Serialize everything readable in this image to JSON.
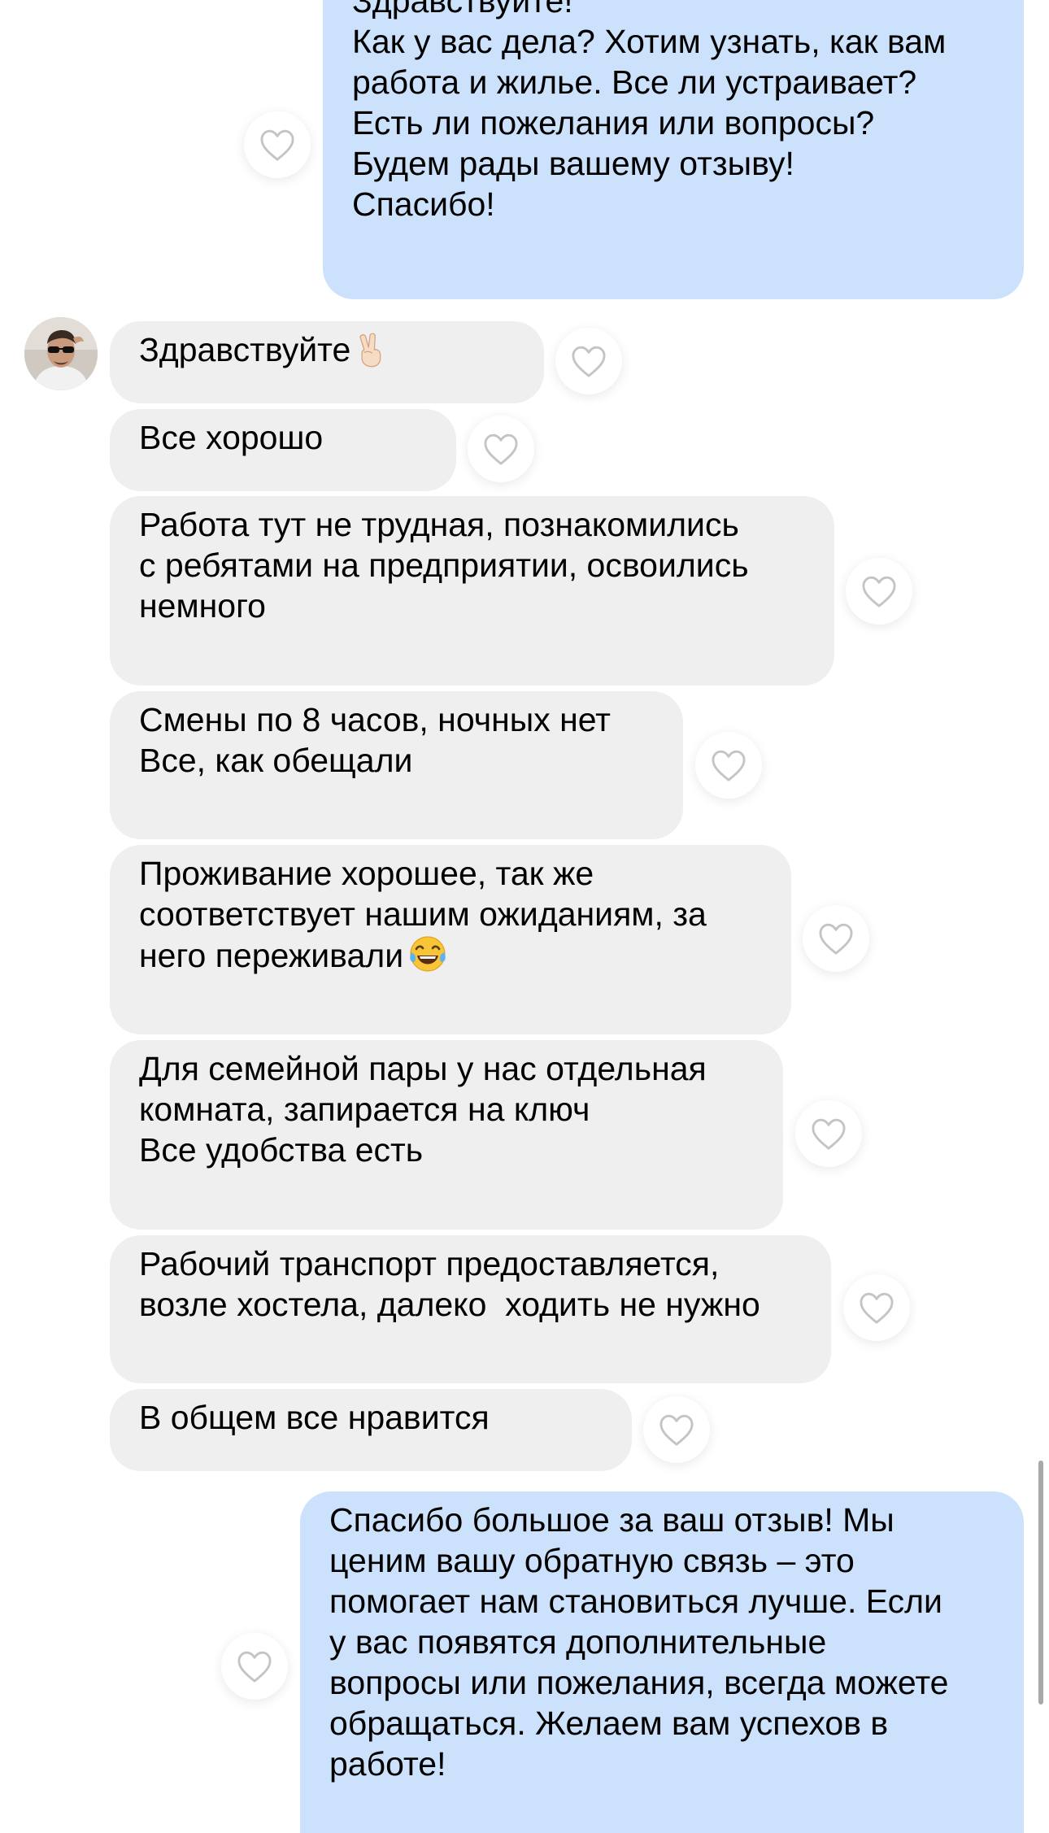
{
  "chat": {
    "messages": [
      {
        "id": "m1",
        "direction": "outgoing",
        "lines": [
          "Здравствуйте!",
          "Как у вас дела? Хотим узнать, как вам",
          "работа и жилье. Все ли устраивает?",
          "Есть ли пожелания или вопросы?",
          "Будем рады вашему отзыву!",
          "Спасибо!"
        ]
      },
      {
        "id": "m2",
        "direction": "incoming",
        "lines": [
          "Здравствуйте"
        ],
        "emoji": "victory-hand-emoji"
      },
      {
        "id": "m3",
        "direction": "incoming",
        "lines": [
          "Все хорошо"
        ]
      },
      {
        "id": "m4",
        "direction": "incoming",
        "lines": [
          "Работа тут не трудная, познакомились",
          "с ребятами на предприятии, освоились",
          "немного"
        ]
      },
      {
        "id": "m5",
        "direction": "incoming",
        "lines": [
          "Смены по 8 часов, ночных нет",
          "Все, как обещали"
        ]
      },
      {
        "id": "m6",
        "direction": "incoming",
        "lines": [
          "Проживание хорошее, так же",
          "соответствует нашим ожиданиям, за",
          "него переживали"
        ],
        "emoji": "tears-of-joy-emoji"
      },
      {
        "id": "m7",
        "direction": "incoming",
        "lines": [
          "Для семейной пары у нас отдельная",
          "комната, запирается на ключ",
          "Все удобства есть"
        ]
      },
      {
        "id": "m8",
        "direction": "incoming",
        "lines": [
          "Рабочий транспорт предоставляется,",
          "возле хостела, далеко  ходить не нужно"
        ]
      },
      {
        "id": "m9",
        "direction": "incoming",
        "lines": [
          "В общем все нравится"
        ]
      },
      {
        "id": "m10",
        "direction": "outgoing",
        "lines": [
          "Спасибо большое за ваш отзыв! Мы",
          "ценим вашу обратную связь – это",
          "помогает нам становиться лучше. Если",
          "у вас появятся дополнительные",
          "вопросы или пожелания, всегда можете",
          "обращаться. Желаем вам успехов в",
          "работе!"
        ]
      }
    ],
    "like_icon": "heart-outline-icon",
    "avatar_icon": "user-avatar"
  },
  "colors": {
    "background": "#ffffff",
    "incoming_bubble": "#efefef",
    "outgoing_bubble": "#cce1fb",
    "text": "#000000",
    "like_stroke": "#c4c4c4"
  }
}
